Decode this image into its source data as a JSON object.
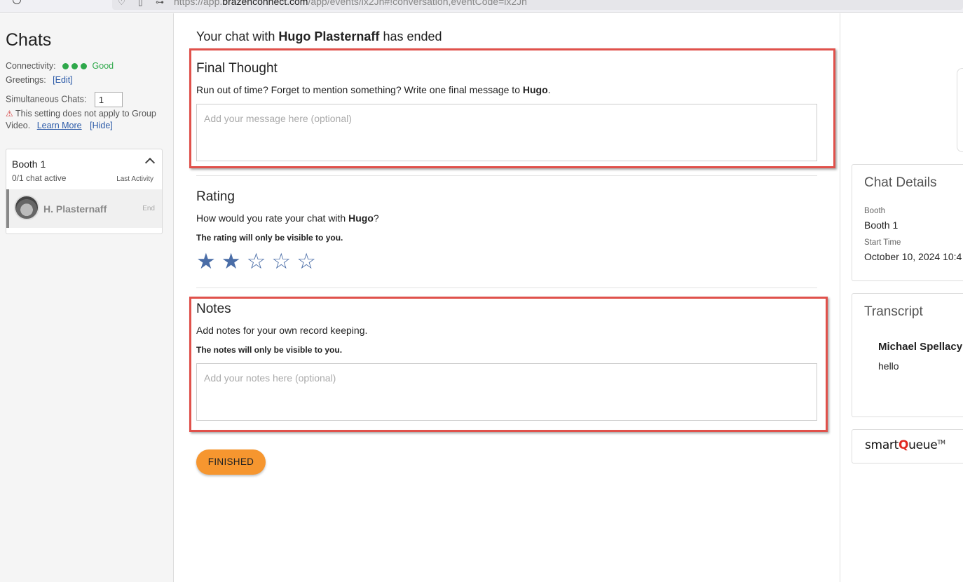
{
  "browser": {
    "url_prefix": "https://app.",
    "url_domain": "brazenconnect.com",
    "url_path": "/app/events/ix2Jh#!conversation,eventCode=ix2Jh"
  },
  "sidebar": {
    "title": "Chats",
    "connectivity_label": "Connectivity:",
    "connectivity_status": "Good",
    "greetings_label": "Greetings:",
    "greetings_edit": "[Edit]",
    "simultaneous_label": "Simultaneous Chats:",
    "simultaneous_value": "1",
    "warning_text_1": "This setting does not apply to Group",
    "warning_text_2": "Video.",
    "learn_more": "Learn More",
    "hide": "[Hide]",
    "booth": {
      "title": "Booth 1",
      "active": "0/1 chat active",
      "last_activity": "Last Activity",
      "chat_name": "H. Plasternaff",
      "end_label": "End"
    }
  },
  "main": {
    "ended_prefix": "Your chat with ",
    "ended_name": "Hugo Plasternaff",
    "ended_suffix": " has ended",
    "final_thought": {
      "title": "Final Thought",
      "desc_prefix": "Run out of time? Forget to mention something? Write one final message to ",
      "desc_name": "Hugo",
      "desc_suffix": ".",
      "placeholder": "Add your message here (optional)"
    },
    "rating": {
      "title": "Rating",
      "desc_prefix": "How would you rate your chat with ",
      "desc_name": "Hugo",
      "desc_suffix": "?",
      "note": "The rating will only be visible to you.",
      "value": 2,
      "max": 5
    },
    "notes": {
      "title": "Notes",
      "desc": "Add notes for your own record keeping.",
      "note": "The notes will only be visible to you.",
      "placeholder": "Add your notes here (optional)"
    },
    "finished_label": "FINISHED"
  },
  "right": {
    "chat_details": {
      "title": "Chat Details",
      "booth_label": "Booth",
      "booth_value": "Booth 1",
      "start_label": "Start Time",
      "start_value": "October 10, 2024 10:4"
    },
    "transcript": {
      "title": "Transcript",
      "sender": "Michael Spellacy",
      "message": "hello"
    },
    "logo": {
      "smart": "smart",
      "q": "Q",
      "ueue": "ueue",
      "tm": "TM"
    }
  },
  "colors": {
    "highlight": "#e0514b",
    "star": "#4a6da7",
    "button": "#f6962f",
    "good": "#2ea84a",
    "link": "#2b5aa8"
  }
}
